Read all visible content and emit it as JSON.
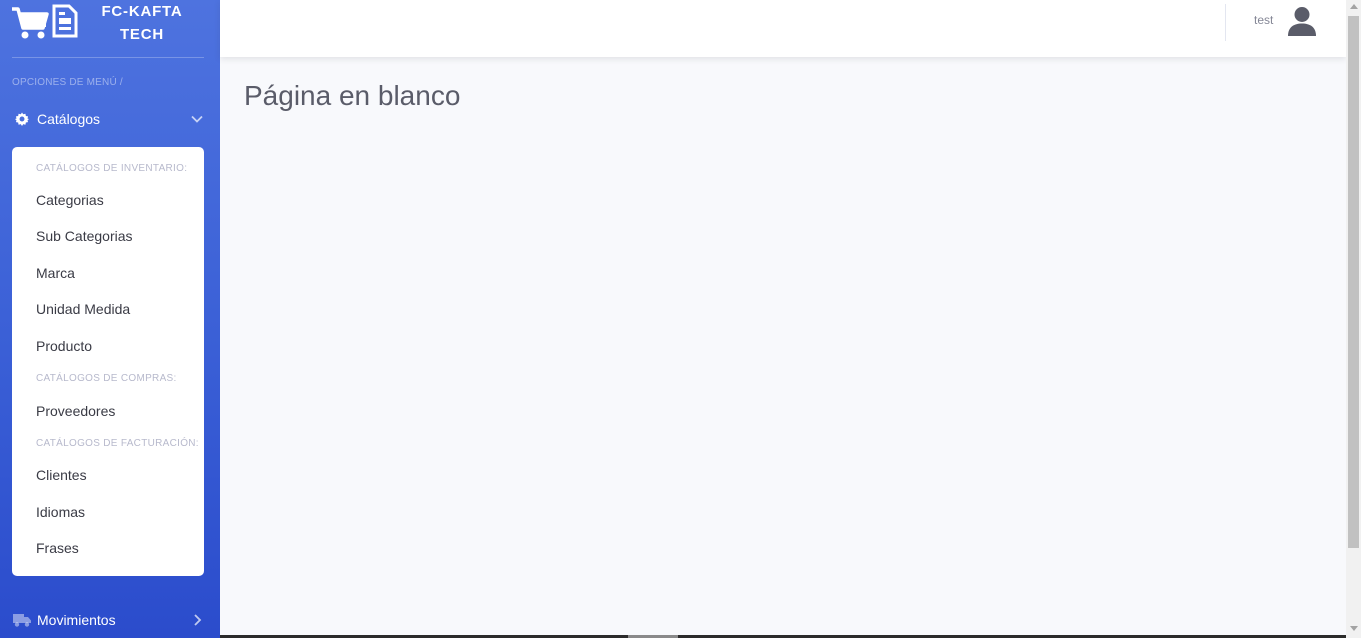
{
  "brand": {
    "name": "FC-KAFTA\nTECH",
    "icons": [
      "cart-icon",
      "document-icon"
    ]
  },
  "sidebar": {
    "heading": "OPCIONES DE MENÚ /",
    "catalogos": {
      "label": "Catálogos",
      "icon": "gear-icon",
      "state": "expanded"
    },
    "submenu": {
      "inventario_heading": "CATÁLOGOS DE INVENTARIO:",
      "inventario_items": [
        "Categorias",
        "Sub Categorias",
        "Marca",
        "Unidad Medida",
        "Producto"
      ],
      "compras_heading": "CATÁLOGOS DE COMPRAS:",
      "compras_items": [
        "Proveedores"
      ],
      "facturacion_heading": "CATÁLOGOS DE FACTURACIÓN:",
      "facturacion_items": [
        "Clientes",
        "Idiomas",
        "Frases"
      ]
    },
    "movimientos": {
      "label": "Movimientos",
      "icon": "truck-icon",
      "state": "collapsed"
    }
  },
  "topbar": {
    "user_name": "test",
    "user_icon": "user-icon"
  },
  "main": {
    "title": "Página en blanco"
  },
  "colors": {
    "sidebar_start": "#4e73df",
    "sidebar_end": "#2b4ccc",
    "background": "#f8f9fc"
  }
}
